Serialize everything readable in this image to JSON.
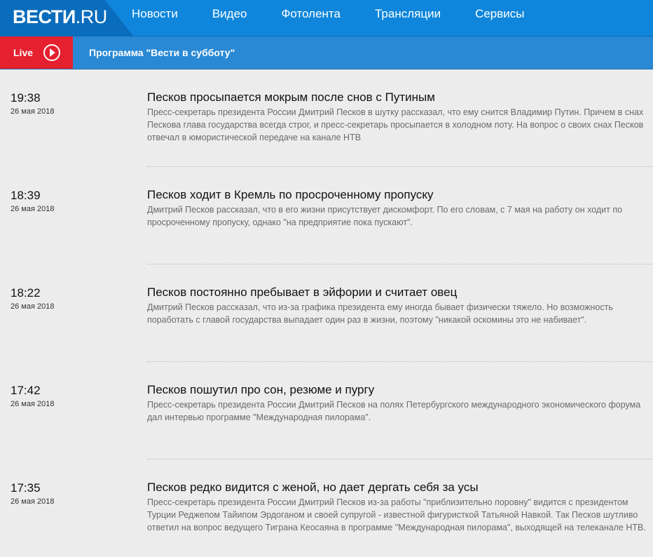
{
  "header": {
    "logo_main": "ВЕСТИ",
    "logo_sub": ".RU",
    "nav": [
      {
        "label": "Новости"
      },
      {
        "label": "Видео"
      },
      {
        "label": "Фотолента"
      },
      {
        "label": "Трансляции"
      },
      {
        "label": "Сервисы"
      }
    ],
    "brand_color": "#0f86db"
  },
  "livebar": {
    "live_label": "Live",
    "program_label": "Программа \"Вести в субботу\"",
    "live_color": "#e5202f",
    "play_icon": "play-circle-icon"
  },
  "news": [
    {
      "time": "19:38",
      "date": "26 мая 2018",
      "title": "Песков просыпается мокрым после снов с Путиным",
      "description": "Пресс-секретарь президента России Дмитрий Песков в шутку рассказал, что ему снится Владимир Путин. Причем в снах Пескова глава государства всегда строг, и пресс-секретарь просыпается в холодном поту. На вопрос о своих снах Песков отвечал в юмористической передаче на канале НТВ"
    },
    {
      "time": "18:39",
      "date": "26 мая 2018",
      "title": "Песков ходит в Кремль по просроченному пропуску",
      "description": "Дмитрий Песков рассказал, что в его жизни присутствует дискомфорт. По его словам, с 7 мая на работу он ходит по просроченному пропуску, однако \"на предприятие пока пускают\"."
    },
    {
      "time": "18:22",
      "date": "26 мая 2018",
      "title": "Песков постоянно пребывает в эйфории и считает овец",
      "description": "Дмитрий Песков рассказал, что из-за графика президента ему иногда бывает физически тяжело. Но возможность поработать с главой государства выпадает один раз в жизни, поэтому \"никакой оскомины это не набивает\"."
    },
    {
      "time": "17:42",
      "date": "26 мая 2018",
      "title": "Песков пошутил про сон, резюме и пургу",
      "description": "Пресс-секретарь президента России Дмитрий Песков на полях Петербургского международного экономического форума дал интервью программе \"Международная пилорама\"."
    },
    {
      "time": "17:35",
      "date": "26 мая 2018",
      "title": "Песков редко видится с женой, но дает дергать себя за усы",
      "description": "Пресс-секретарь президента России Дмитрий Песков из-за работы \"приблизительно поровну\" видится с президентом Турции Реджепом Тайипом Эрдоганом и своей супругой - известной фигуристкой Татьяной Навкой. Так Песков шутливо ответил на вопрос ведущего Тиграна Кеосаяна в программе \"Международная пилорама\", выходящей на телеканале НТВ."
    }
  ]
}
